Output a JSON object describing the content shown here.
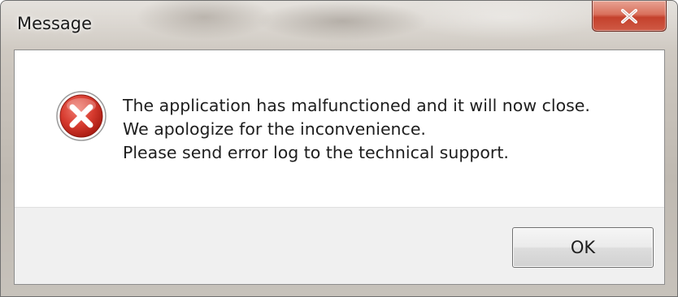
{
  "window": {
    "title": "Message",
    "close_icon": "close-icon"
  },
  "dialog": {
    "icon": "error-icon",
    "message_lines": [
      "The application has malfunctioned and it will now close.",
      "We apologize for the inconvenience.",
      "Please send error log to the technical support."
    ],
    "ok_label": "OK"
  },
  "colors": {
    "close_button": "#c4412c",
    "error_icon": "#c62828",
    "footer_background": "#f0f0f0"
  }
}
